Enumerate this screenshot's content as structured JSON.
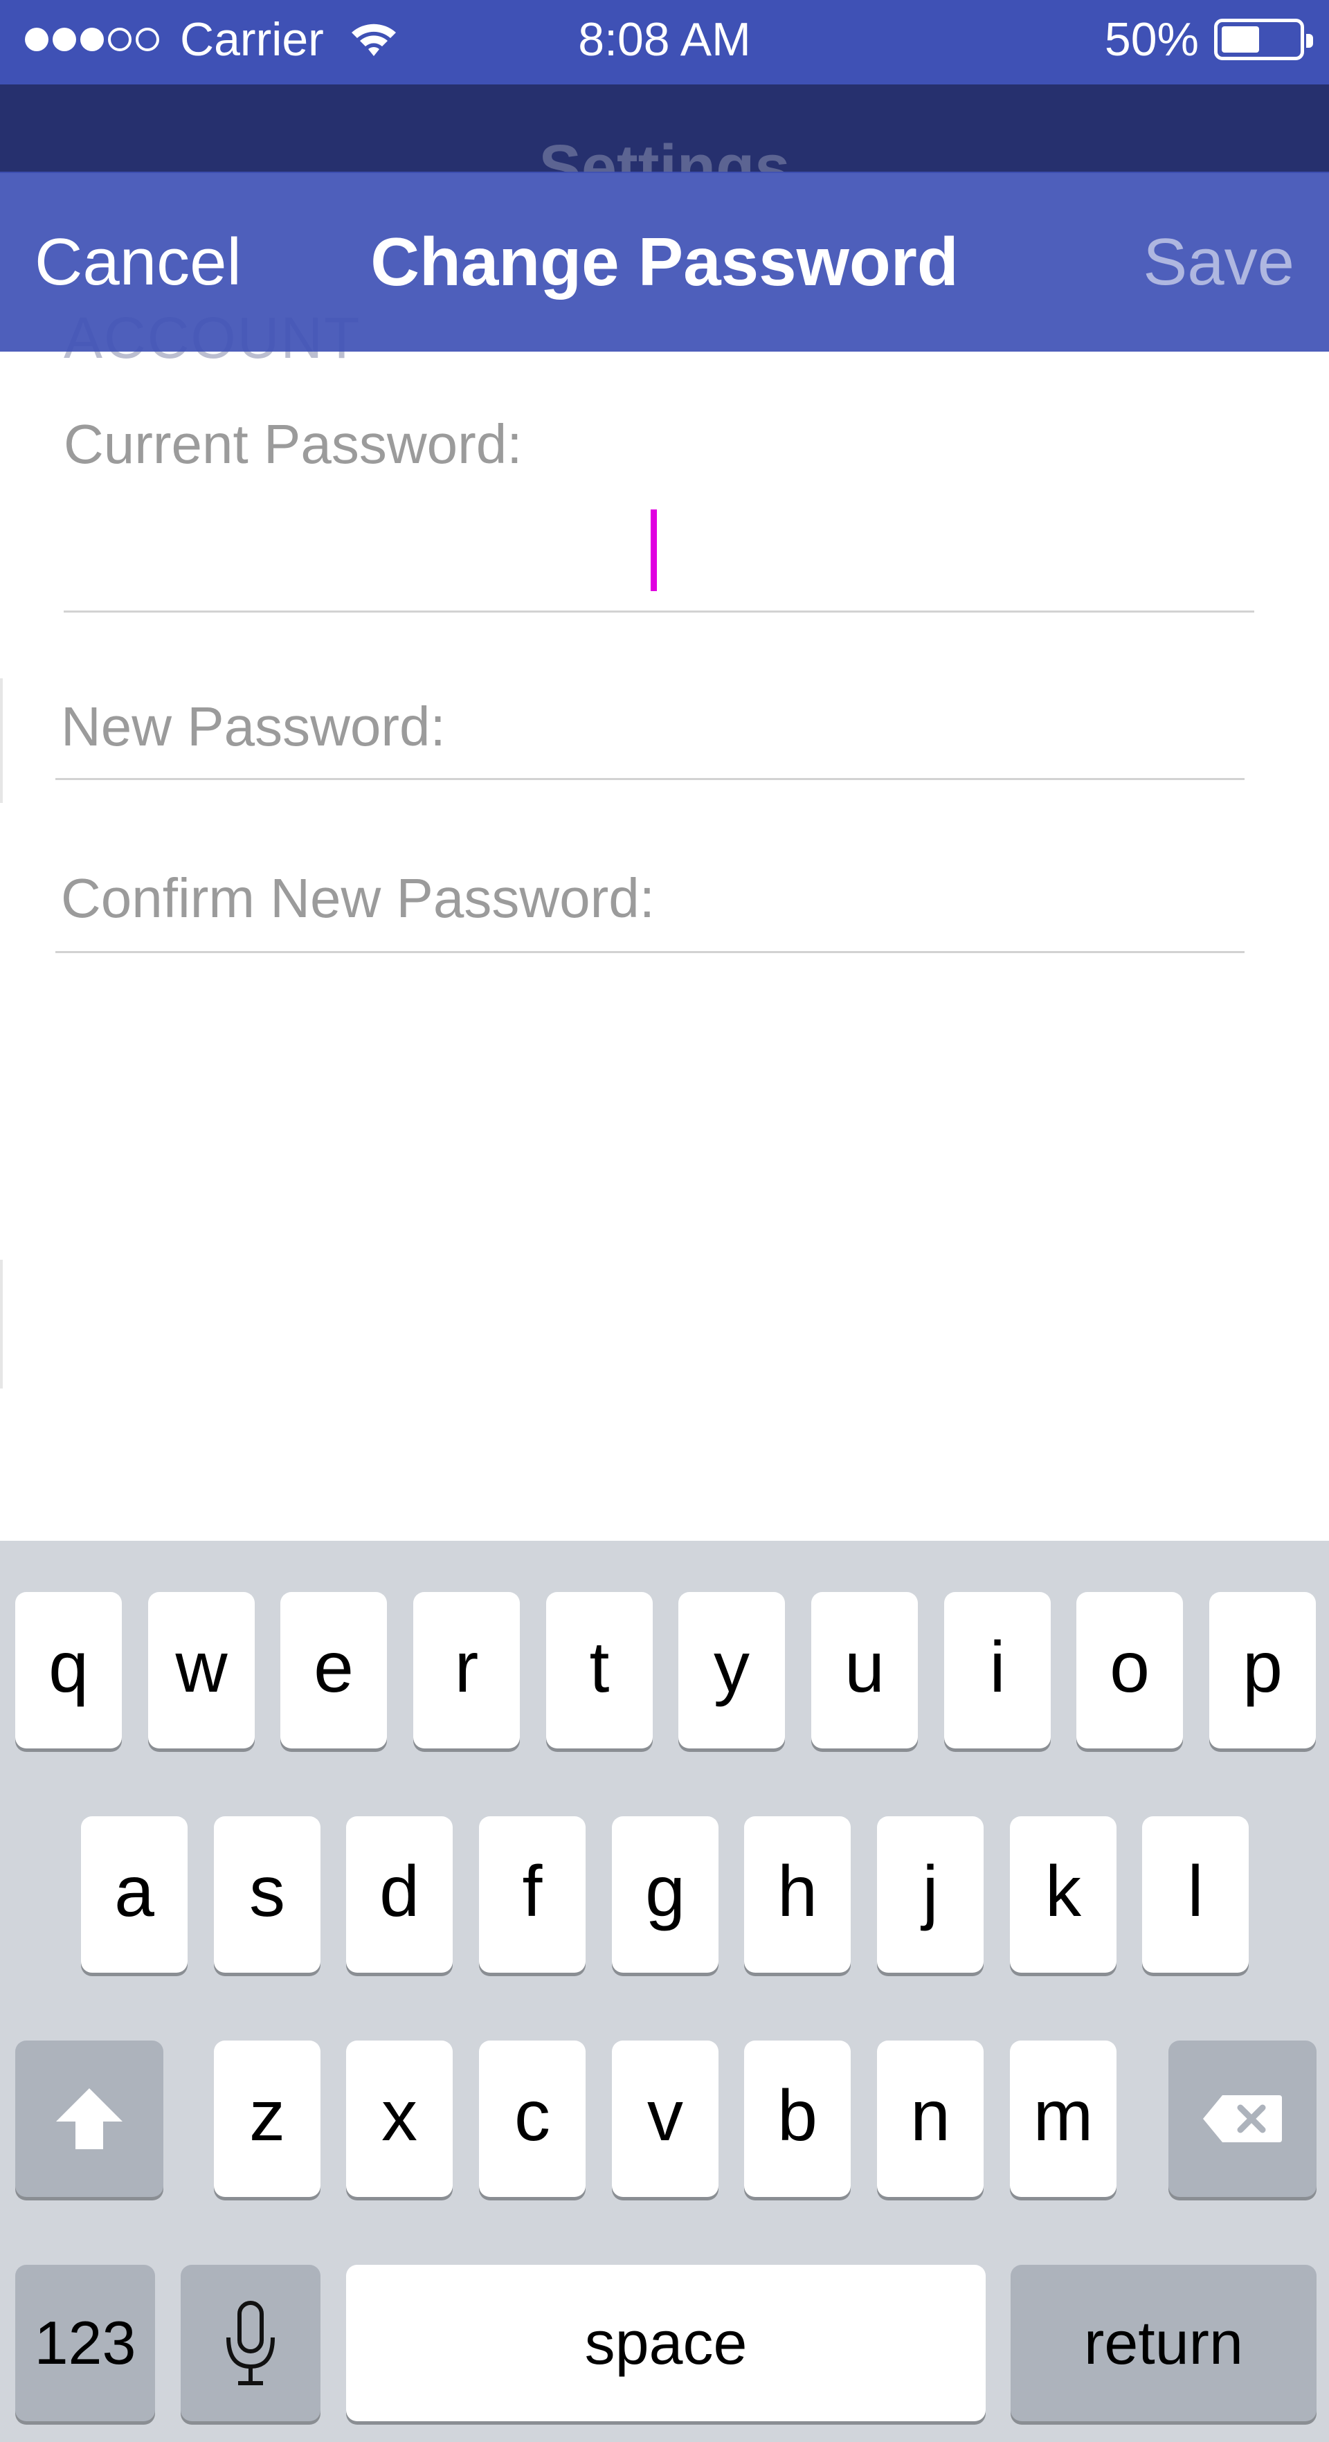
{
  "status_bar": {
    "signal_bars_filled": 3,
    "signal_bars_total": 5,
    "carrier": "Carrier",
    "wifi_icon": "wifi-icon",
    "time": "8:08 AM",
    "battery_percent": "50%",
    "battery_level": 0.5
  },
  "background_screen": {
    "title": "Settings",
    "section_header": "ACCOUNT"
  },
  "nav": {
    "cancel_label": "Cancel",
    "title": "Change Password",
    "save_label": "Save"
  },
  "form": {
    "current_password": {
      "label": "Current Password:",
      "value": ""
    },
    "new_password": {
      "label": "New Password:",
      "value": ""
    },
    "confirm_password": {
      "label": "Confirm New Password:",
      "value": ""
    }
  },
  "keyboard": {
    "row1": [
      "q",
      "w",
      "e",
      "r",
      "t",
      "y",
      "u",
      "i",
      "o",
      "p"
    ],
    "row2": [
      "a",
      "s",
      "d",
      "f",
      "g",
      "h",
      "j",
      "k",
      "l"
    ],
    "row3": [
      "z",
      "x",
      "c",
      "v",
      "b",
      "n",
      "m"
    ],
    "shift_icon": "shift-arrow-icon",
    "delete_icon": "delete-backspace-icon",
    "numbers_label": "123",
    "mic_icon": "microphone-icon",
    "space_label": "space",
    "return_label": "return"
  },
  "colors": {
    "status_bar": "#3f51b5",
    "nav_bar": "#3f51b5",
    "cursor": "#e000e0",
    "keyboard_bg": "#d1d5db",
    "special_key": "#adb3bc"
  }
}
